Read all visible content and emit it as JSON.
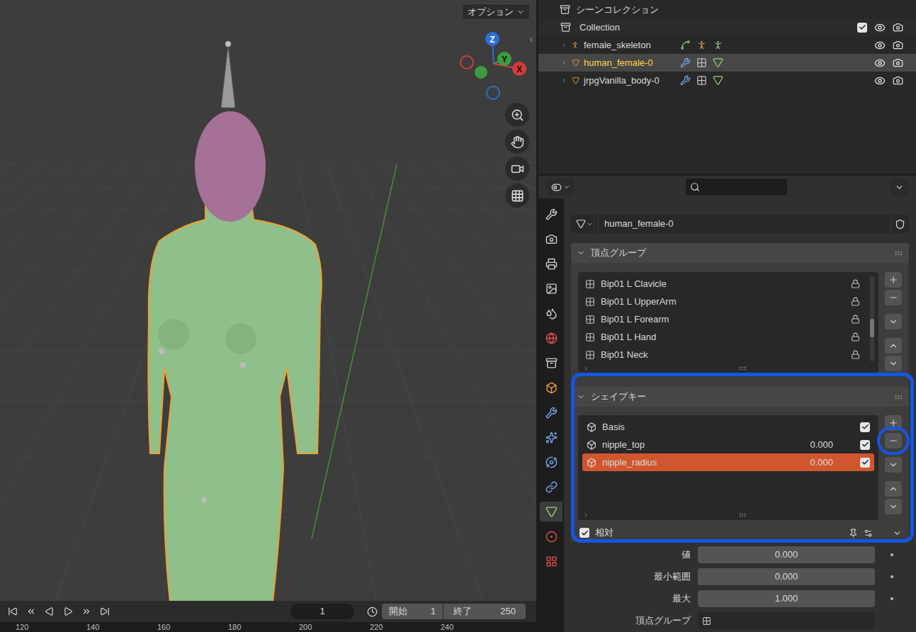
{
  "viewport": {
    "options_label": "オプション",
    "gizmo": [
      {
        "label": "Z",
        "color": "#2d6fd6"
      },
      {
        "label": "Y",
        "color": "#3f9b3f"
      },
      {
        "label": "X",
        "color": "#d63a3a"
      }
    ]
  },
  "timeline": {
    "current_frame": "1",
    "start_label": "開始",
    "start": "1",
    "end_label": "終了",
    "end": "250",
    "ruler": [
      "120",
      "140",
      "160",
      "180",
      "200",
      "220",
      "240"
    ]
  },
  "outliner": {
    "root": "シーンコレクション",
    "items": [
      {
        "name": "Collection",
        "kind": "collection",
        "selected": false,
        "checked": true
      },
      {
        "name": "female_skeleton",
        "kind": "armature",
        "selected": false
      },
      {
        "name": "human_female-0",
        "kind": "mesh",
        "selected": true
      },
      {
        "name": "jrpgVanilla_body-0",
        "kind": "mesh",
        "selected": false
      }
    ]
  },
  "properties": {
    "tabs": [
      {
        "selected": false
      },
      {
        "selected": false
      },
      {
        "selected": false
      },
      {
        "selected": false
      },
      {
        "selected": false
      },
      {
        "selected": false
      },
      {
        "selected": false
      },
      {
        "selected": false
      },
      {
        "selected": false
      },
      {
        "selected": false
      },
      {
        "selected": false
      },
      {
        "selected": false
      },
      {
        "selected": true
      },
      {
        "selected": false
      },
      {
        "selected": false
      }
    ],
    "object_name": "human_female-0",
    "vertex_groups": {
      "title": "頂点グループ",
      "expanded": true,
      "items": [
        {
          "name": "Bip01 L Clavicle"
        },
        {
          "name": "Bip01 L UpperArm"
        },
        {
          "name": "Bip01 L Forearm"
        },
        {
          "name": "Bip01 L Hand"
        },
        {
          "name": "Bip01 Neck"
        }
      ]
    },
    "shape_keys": {
      "title": "シェイプキー",
      "expanded": true,
      "items": [
        {
          "name": "Basis",
          "value": "",
          "enabled": true,
          "selected": false
        },
        {
          "name": "nipple_top",
          "value": "0.000",
          "enabled": true,
          "selected": false
        },
        {
          "name": "nipple_radius",
          "value": "0.000",
          "enabled": true,
          "selected": true
        }
      ],
      "relative_label": "相対",
      "relative": true
    },
    "fields": [
      {
        "label": "値",
        "value": "0.000",
        "kind": "number"
      },
      {
        "label": "最小範囲",
        "value": "0.000",
        "kind": "number"
      },
      {
        "label": "最大",
        "value": "1.000",
        "kind": "number"
      },
      {
        "label": "頂点グループ",
        "value": "",
        "kind": "group"
      }
    ]
  }
}
